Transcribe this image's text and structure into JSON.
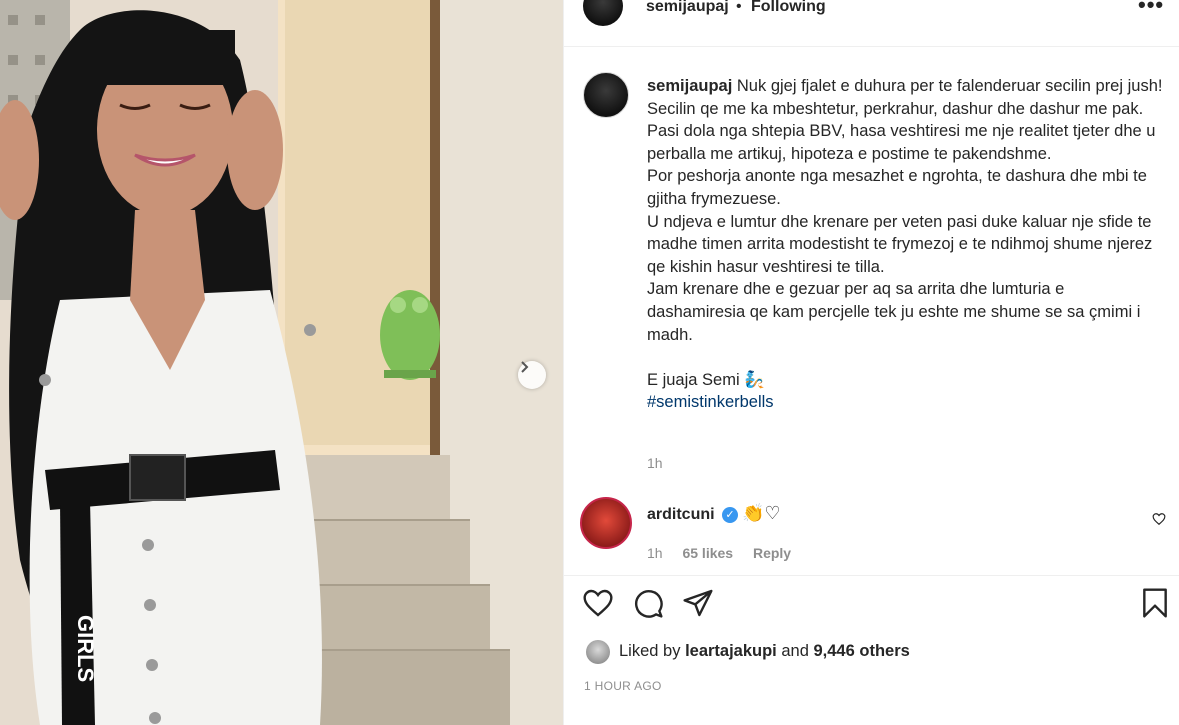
{
  "post": {
    "image_alt": "",
    "photo_text": "GIRLS"
  },
  "header": {
    "username": "semijaupaj",
    "separator": "•",
    "follow_status": "Following",
    "more_icon": "more-dots-icon"
  },
  "caption": {
    "username": "semijaupaj",
    "lines": [
      "Nuk gjej fjalet e duhura per te falenderuar secilin prej jush!",
      "Secilin qe me ka mbeshtetur, perkrahur, dashur dhe dashur me pak.",
      "Pasi dola nga shtepia BBV, hasa veshtiresi me nje realitet tjeter dhe u perballa me artikuj, hipoteza e postime te pakendshme.",
      "Por peshorja anonte nga mesazhet e ngrohta, te dashura dhe mbi te gjitha frymezuese.",
      "U ndjeva e lumtur dhe krenare per veten pasi duke kaluar nje sfide te madhe timen arrita modestisht te frymezoj e te ndihmoj shume njerez qe kishin hasur veshtiresi te tilla.",
      "Jam krenare dhe e gezuar per aq sa arrita dhe lumturia e dashamiresia qe kam percjelle tek ju eshte me shume se sa çmimi i madh."
    ],
    "signoff": "E juaja Semi 🧞",
    "hashtag": "#semistinkerbells",
    "time": "1h"
  },
  "comment": {
    "username": "arditcuni",
    "verified": true,
    "text": "👏♡",
    "time": "1h",
    "likes": "65 likes",
    "reply_label": "Reply"
  },
  "actions": {
    "icons": [
      "heart-icon",
      "comment-icon",
      "share-icon",
      "bookmark-icon"
    ]
  },
  "likes": {
    "prefix": "Liked by",
    "user": "leartajakupi",
    "conjunction": "and",
    "others": "9,446 others"
  },
  "posted_time": "1 HOUR AGO",
  "colors": {
    "hashtag": "#00376b",
    "muted": "#8e8e8e",
    "verified": "#3897f0",
    "text": "#262626"
  }
}
